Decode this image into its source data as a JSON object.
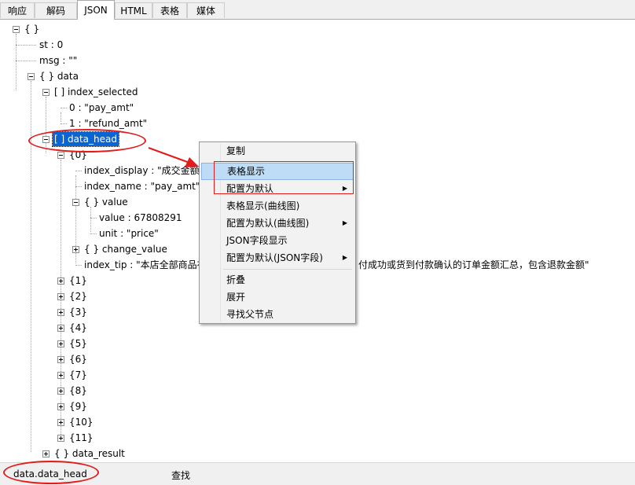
{
  "tabs": [
    {
      "label": "响应"
    },
    {
      "label": "解码"
    },
    {
      "label": "JSON"
    },
    {
      "label": "HTML"
    },
    {
      "label": "表格"
    },
    {
      "label": "媒体"
    }
  ],
  "active_tab": "JSON",
  "tree": {
    "root": "{ }",
    "st": "st : 0",
    "msg": "msg : \"\"",
    "data": "{ } data",
    "index_selected": "[ ] index_selected",
    "idx0": "0 : \"pay_amt\"",
    "idx1": "1 : \"refund_amt\"",
    "data_head": "[ ] data_head",
    "item0": "{0}",
    "index_display": "index_display : \"成交金额\"",
    "index_name": "index_name : \"pay_amt\"",
    "value_obj": "{ } value",
    "value": "value : 67808291",
    "unit": "unit : \"price\"",
    "change_value": "{ } change_value",
    "index_tip_start": "index_tip : \"本店全部商品在",
    "index_tip_end": "付成功或货到付款确认的订单金额汇总，包含退款金额\"",
    "items": [
      "{1}",
      "{2}",
      "{3}",
      "{4}",
      "{5}",
      "{6}",
      "{7}",
      "{8}",
      "{9}",
      "{10}",
      "{11}"
    ],
    "data_result": "{ } data_result"
  },
  "context_menu": {
    "items": [
      {
        "label": "复制",
        "submenu": false
      },
      {
        "label": "表格显示",
        "submenu": false
      },
      {
        "label": "配置为默认",
        "submenu": true
      },
      {
        "label": "表格显示(曲线图)",
        "submenu": false
      },
      {
        "label": "配置为默认(曲线图)",
        "submenu": true
      },
      {
        "label": "JSON字段显示",
        "submenu": false
      },
      {
        "label": "配置为默认(JSON字段)",
        "submenu": true
      },
      {
        "label": "折叠",
        "submenu": false
      },
      {
        "label": "展开",
        "submenu": false
      },
      {
        "label": "寻找父节点",
        "submenu": false
      }
    ],
    "hovered": "表格显示",
    "submenu_arrow": "▶"
  },
  "status": {
    "path": "data.data_head",
    "find_label": "查找"
  },
  "colors": {
    "selection": "#0a64d2",
    "annotation": "#e21b1b",
    "menu_hover": "#bfdcf6"
  },
  "icons": [
    "expand-box-icon",
    "collapse-box-icon",
    "submenu-arrow-icon"
  ]
}
